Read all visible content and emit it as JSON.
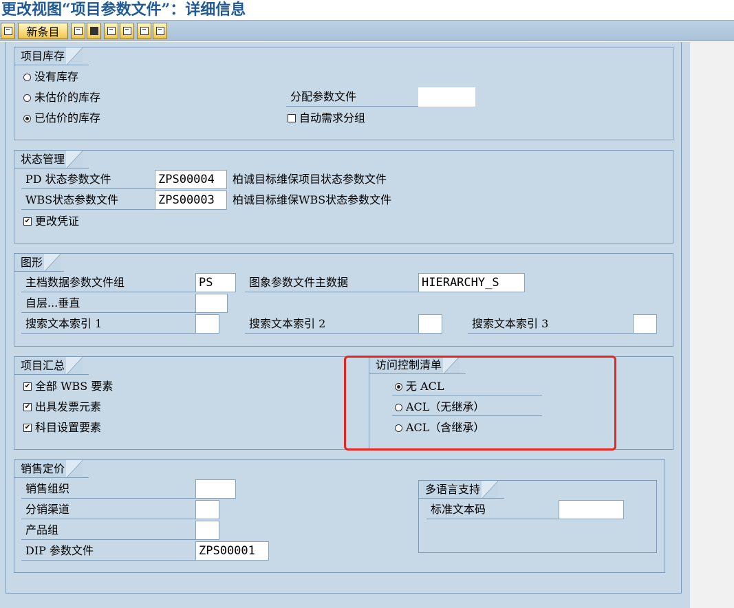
{
  "title": "更改视图“项目参数文件”：详细信息",
  "toolbar": {
    "new_entries": "新条目"
  },
  "stock": {
    "title": "项目库存",
    "options": [
      "没有库存",
      "未估价的库存",
      "已估价的库存"
    ],
    "selected": 2,
    "assign_profile_label": "分配参数文件",
    "assign_profile_value": "",
    "auto_req_grouping_label": "自动需求分组"
  },
  "status": {
    "title": "状态管理",
    "pd_label": "PD 状态参数文件",
    "pd_value": "ZPS00004",
    "pd_desc": "柏诚目标维保项目状态参数文件",
    "wbs_label": "WBS状态参数文件",
    "wbs_value": "ZPS00003",
    "wbs_desc": "柏诚目标维保WBS状态参数文件",
    "change_docs_label": "更改凭证"
  },
  "graphics": {
    "title": "图形",
    "master_group_label": "主档数据参数文件组",
    "master_group_value": "PS",
    "graphic_profile_label": "图象参数文件主数据",
    "graphic_profile_value": "HIERARCHY_S",
    "hierarchy_label": "自层...垂直",
    "hierarchy_value": "",
    "search1_label": "搜索文本索引 1",
    "search2_label": "搜索文本索引 2",
    "search3_label": "搜索文本索引 3"
  },
  "summary": {
    "title": "项目汇总",
    "items": [
      "全部 WBS 要素",
      "出具发票元素",
      "科目设置要素"
    ]
  },
  "acl": {
    "title": "访问控制清单",
    "options": [
      "无 ACL",
      "ACL（无继承）",
      "ACL（含继承）"
    ],
    "selected": 0
  },
  "sales": {
    "title": "销售定价",
    "sales_org_label": "销售组织",
    "distr_channel_label": "分销渠道",
    "division_label": "产品组",
    "dip_label": "DIP 参数文件",
    "dip_value": "ZPS00001"
  },
  "multilang": {
    "title": "多语言支持",
    "std_text_label": "标准文本码"
  },
  "colors": {
    "highlight": "#e8241e",
    "panel": "#c7d9e7",
    "title": "#1f5a96"
  }
}
